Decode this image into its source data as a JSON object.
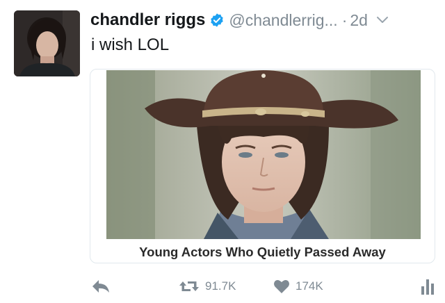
{
  "tweet": {
    "display_name": "chandler riggs",
    "handle": "@chandlerrig...",
    "separator": "·",
    "timestamp": "2d",
    "text": "i wish LOL"
  },
  "card": {
    "title": "Young Actors Who Quietly Passed Away"
  },
  "actions": {
    "reply_icon": "reply-icon",
    "retweet_count": "91.7K",
    "like_count": "174K",
    "analytics_icon": "bar-chart-icon"
  },
  "colors": {
    "verified_blue": "#1da1f2",
    "muted_gray": "#7f8a93",
    "text": "#14171a",
    "card_border": "#e1e8ed"
  }
}
